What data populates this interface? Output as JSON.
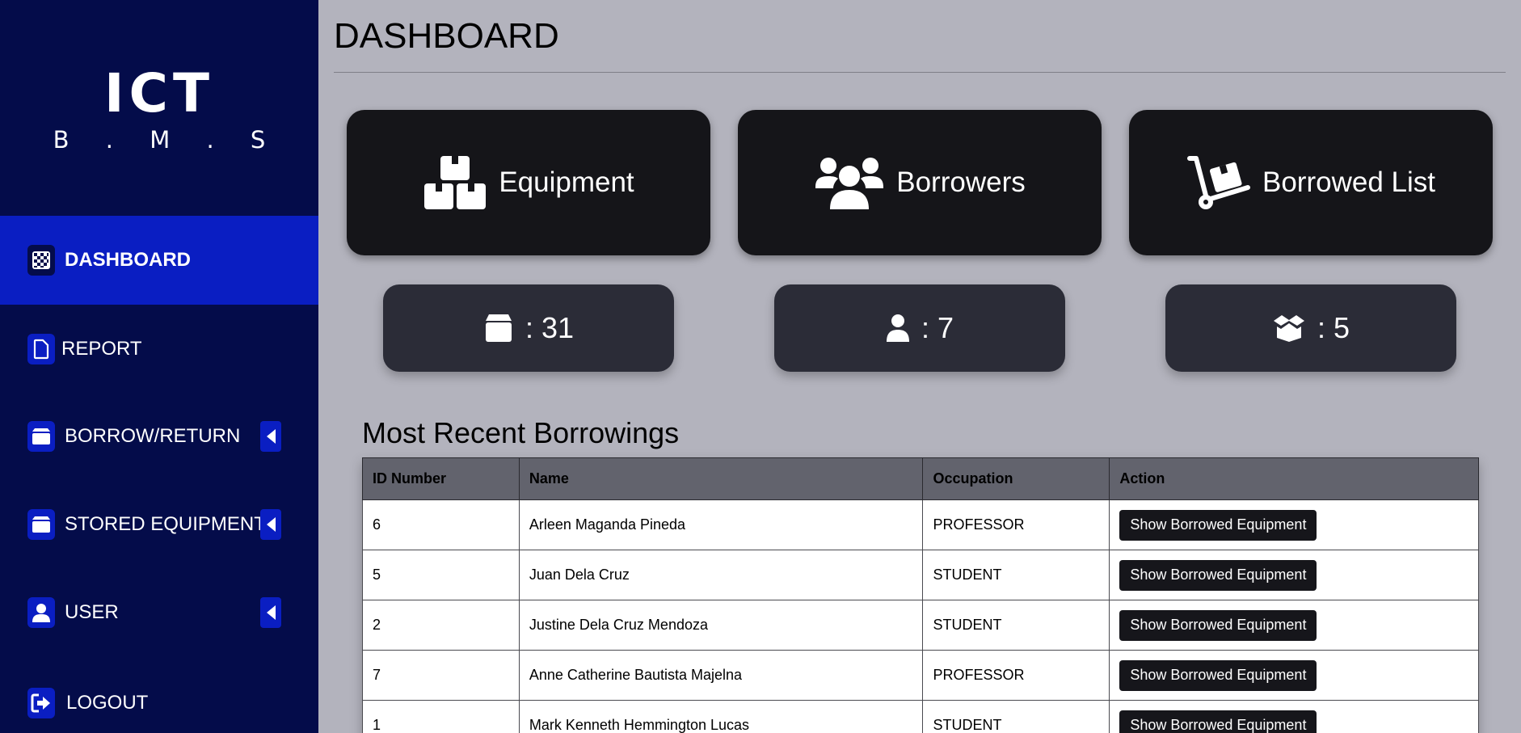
{
  "logo": {
    "main": "ICT",
    "sub": "B.M.S"
  },
  "sidebar": {
    "items": [
      {
        "label": "DASHBOARD",
        "icon": "checkered-grid-icon"
      },
      {
        "label": "REPORT",
        "icon": "file-icon"
      },
      {
        "label": "BORROW/RETURN",
        "icon": "box-icon"
      },
      {
        "label": "STORED EQUIPMENT",
        "icon": "box-icon"
      },
      {
        "label": "USER",
        "icon": "user-icon"
      },
      {
        "label": "LOGOUT",
        "icon": "logout-icon"
      }
    ]
  },
  "header": {
    "title": "DASHBOARD"
  },
  "cards": [
    {
      "label": "Equipment",
      "icon": "boxes-icon"
    },
    {
      "label": "Borrowers",
      "icon": "users-icon"
    },
    {
      "label": "Borrowed List",
      "icon": "hand-truck-icon"
    }
  ],
  "stats": [
    {
      "text": ": 31",
      "icon": "box-icon"
    },
    {
      "text": ": 7",
      "icon": "user-icon"
    },
    {
      "text": ": 5",
      "icon": "open-box-icon"
    }
  ],
  "recent": {
    "title": "Most Recent Borrowings",
    "columns": [
      "ID Number",
      "Name",
      "Occupation",
      "Action"
    ],
    "action_label": "Show Borrowed Equipment",
    "rows": [
      {
        "id": "6",
        "name": "Arleen Maganda Pineda",
        "occupation": "PROFESSOR"
      },
      {
        "id": "5",
        "name": "Juan Dela Cruz",
        "occupation": "STUDENT"
      },
      {
        "id": "2",
        "name": "Justine Dela Cruz Mendoza",
        "occupation": "STUDENT"
      },
      {
        "id": "7",
        "name": "Anne Catherine Bautista Majelna",
        "occupation": "PROFESSOR"
      },
      {
        "id": "1",
        "name": "Mark Kenneth Hemmington Lucas",
        "occupation": "STUDENT"
      }
    ]
  },
  "colors": {
    "sidebar_bg": "#040c4a",
    "accent": "#0a1ec2",
    "card_bg": "#151519",
    "stat_bg": "#2b2c37",
    "page_bg": "#b3b3bd"
  }
}
